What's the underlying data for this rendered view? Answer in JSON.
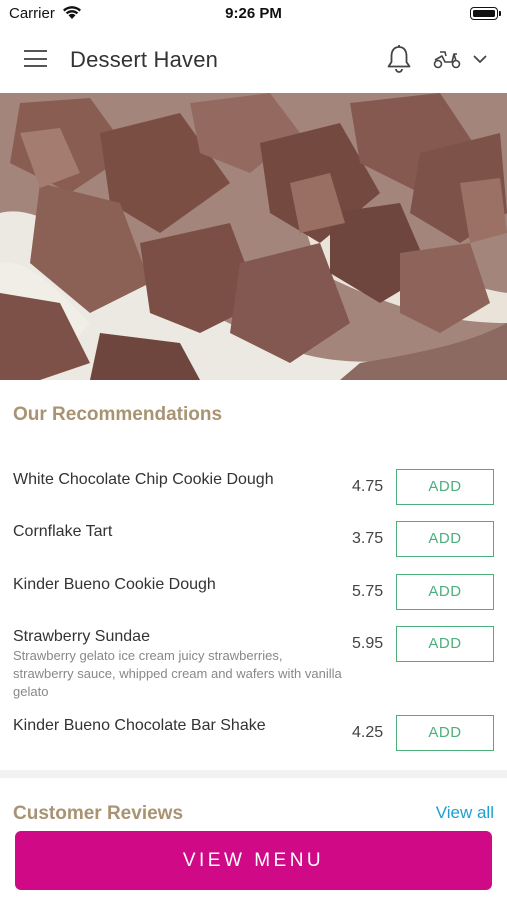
{
  "status_bar": {
    "carrier": "Carrier",
    "time": "9:26 PM"
  },
  "header": {
    "title": "Dessert Haven",
    "icons": [
      "hamburger-menu-icon",
      "bell-icon",
      "scooter-icon",
      "chevron-down-icon"
    ]
  },
  "recommendations": {
    "title": "Our Recommendations",
    "items": [
      {
        "name": "White Chocolate Chip Cookie Dough",
        "description": "",
        "price": "4.75",
        "button": "ADD"
      },
      {
        "name": "Cornflake Tart",
        "description": "",
        "price": "3.75",
        "button": "ADD"
      },
      {
        "name": "Kinder Bueno Cookie Dough",
        "description": "",
        "price": "5.75",
        "button": "ADD"
      },
      {
        "name": "Strawberry Sundae",
        "description": "Strawberry gelato ice cream juicy strawberries, strawberry sauce, whipped cream and wafers with vanilla gelato",
        "price": "5.95",
        "button": "ADD"
      },
      {
        "name": "Kinder Bueno Chocolate Bar Shake",
        "description": "",
        "price": "4.25",
        "button": "ADD"
      }
    ]
  },
  "reviews": {
    "title": "Customer Reviews",
    "view_all": "View all"
  },
  "footer": {
    "view_menu": "VIEW MENU"
  },
  "colors": {
    "accent_gold": "#a89372",
    "add_green": "#4caf7a",
    "link_blue": "#1f9fd0",
    "cta_magenta": "#d00a87"
  }
}
